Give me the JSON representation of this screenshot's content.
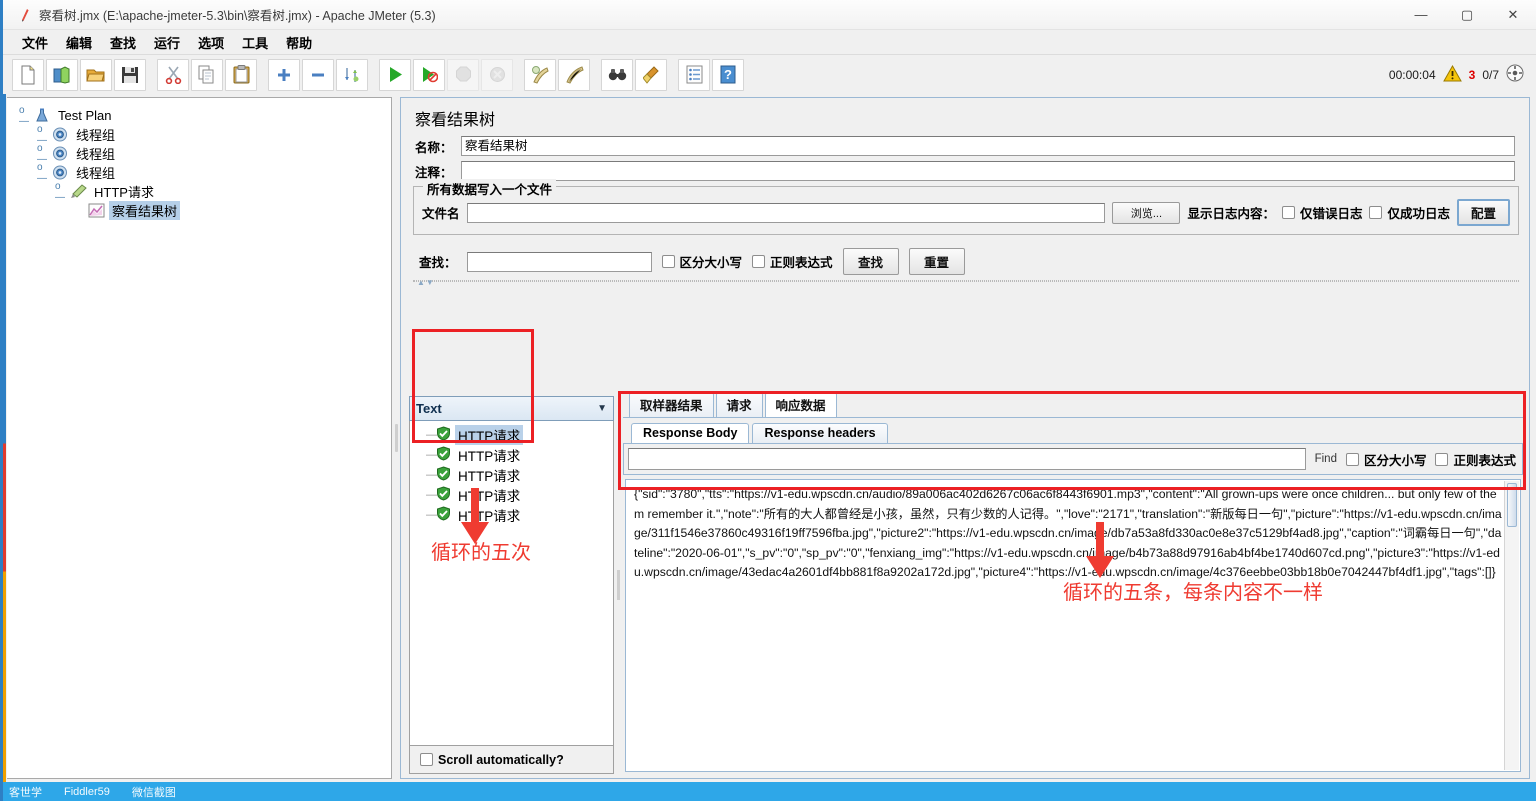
{
  "window": {
    "title": "察看树.jmx (E:\\apache-jmeter-5.3\\bin\\察看树.jmx) - Apache JMeter (5.3)",
    "minimize": "—",
    "maximize": "▢",
    "close": "✕"
  },
  "menu": {
    "items": [
      {
        "label": "文件"
      },
      {
        "label": "编辑"
      },
      {
        "label": "查找"
      },
      {
        "label": "运行"
      },
      {
        "label": "选项"
      },
      {
        "label": "工具"
      },
      {
        "label": "帮助"
      }
    ]
  },
  "toolbar": {
    "buttons": [
      {
        "name": "new-icon",
        "glyph": "📄"
      },
      {
        "name": "templates-icon",
        "glyph": "📚"
      },
      {
        "name": "open-icon",
        "glyph": "📂"
      },
      {
        "name": "save-icon",
        "glyph": "💾"
      },
      {
        "name": "cut-icon",
        "glyph": "✂"
      },
      {
        "name": "copy-icon",
        "glyph": "🗐"
      },
      {
        "name": "paste-icon",
        "glyph": "📋"
      },
      {
        "name": "expand-icon",
        "glyph": "＋"
      },
      {
        "name": "collapse-icon",
        "glyph": "－"
      },
      {
        "name": "toggle-icon",
        "glyph": "⇅"
      },
      {
        "name": "start-icon",
        "glyph": "▶"
      },
      {
        "name": "start-no-pauses-icon",
        "glyph": "▶"
      },
      {
        "name": "stop-icon",
        "glyph": "⬤"
      },
      {
        "name": "shutdown-icon",
        "glyph": "⊗"
      },
      {
        "name": "clear-icon",
        "glyph": "🧹"
      },
      {
        "name": "clear-all-icon",
        "glyph": "🧹"
      },
      {
        "name": "search-icon",
        "glyph": "🔍"
      },
      {
        "name": "reset-search-icon",
        "glyph": "🖌"
      },
      {
        "name": "function-helper-icon",
        "glyph": "📋"
      },
      {
        "name": "help-icon",
        "glyph": "?"
      }
    ],
    "status": {
      "elapsed": "00:00:04",
      "warning_count": "3",
      "threads": "0/7"
    }
  },
  "tree": {
    "nodes": [
      {
        "label": "Test Plan",
        "icon": "test-plan-icon",
        "level": 0,
        "selected": false
      },
      {
        "label": "线程组",
        "icon": "thread-group-icon",
        "level": 1,
        "selected": false
      },
      {
        "label": "线程组",
        "icon": "thread-group-icon",
        "level": 1,
        "selected": false
      },
      {
        "label": "线程组",
        "icon": "thread-group-icon",
        "level": 1,
        "selected": false
      },
      {
        "label": "HTTP请求",
        "icon": "http-request-icon",
        "level": 2,
        "selected": false
      },
      {
        "label": "察看结果树",
        "icon": "view-results-tree-icon",
        "level": 3,
        "selected": true
      }
    ]
  },
  "panel": {
    "title": "察看结果树",
    "name_label": "名称：",
    "name_value": "察看结果树",
    "comment_label": "注释：",
    "comment_value": "",
    "file_group_title": "所有数据写入一个文件",
    "filename_label": "文件名",
    "filename_value": "",
    "browse_button": "浏览...",
    "log_display_label": "显示日志内容：",
    "errors_only_label": "仅错误日志",
    "successes_only_label": "仅成功日志",
    "configure_button": "配置"
  },
  "search": {
    "label": "查找：",
    "value": "",
    "case_sensitive_label": "区分大小写",
    "regex_label": "正则表达式",
    "find_button": "查找",
    "reset_button": "重置"
  },
  "results": {
    "render_selector": "Text",
    "items": [
      {
        "label": "HTTP请求",
        "status": "success",
        "selected": true
      },
      {
        "label": "HTTP请求",
        "status": "success",
        "selected": false
      },
      {
        "label": "HTTP请求",
        "status": "success",
        "selected": false
      },
      {
        "label": "HTTP请求",
        "status": "success",
        "selected": false
      },
      {
        "label": "HTTP请求",
        "status": "success",
        "selected": false
      }
    ],
    "scroll_auto_label": "Scroll automatically?"
  },
  "detail": {
    "tabs": [
      {
        "label": "取样器结果",
        "active": false
      },
      {
        "label": "请求",
        "active": false
      },
      {
        "label": "响应数据",
        "active": true
      }
    ],
    "subtabs": [
      {
        "label": "Response Body",
        "active": true
      },
      {
        "label": "Response headers",
        "active": false
      }
    ],
    "find_value": "",
    "find_button": "Find",
    "case_sensitive_label": "区分大小写",
    "regex_label": "正则表达式",
    "response_body": "{\"sid\":\"3780\",\"tts\":\"https://v1-edu.wpscdn.cn/audio/89a006ac402d6267c06ac6f8443f6901.mp3\",\"content\":\"All grown-ups were once children... but only few of them remember it.\",\"note\":\"所有的大人都曾经是小孩，虽然，只有少数的人记得。\",\"love\":\"2171\",\"translation\":\"新版每日一句\",\"picture\":\"https://v1-edu.wpscdn.cn/image/311f1546e37860c49316f19ff7596fba.jpg\",\"picture2\":\"https://v1-edu.wpscdn.cn/image/db7a53a8fd330ac0e8e37c5129bf4ad8.jpg\",\"caption\":\"词霸每日一句\",\"dateline\":\"2020-06-01\",\"s_pv\":\"0\",\"sp_pv\":\"0\",\"fenxiang_img\":\"https://v1-edu.wpscdn.cn/image/b4b73a88d97916ab4bf4be1740d607cd.png\",\"picture3\":\"https://v1-edu.wpscdn.cn/image/43edac4a2601df4bb881f8a9202a172d.jpg\",\"picture4\":\"https://v1-edu.wpscdn.cn/image/4c376eebbe03bb18b0e7042447bf4df1.jpg\",\"tags\":[]}"
  },
  "annotations": {
    "left_note": "循环的五次",
    "right_note": "循环的五条，每条内容不一样",
    "color": "#ef3b31"
  },
  "taskbar": {
    "items": [
      {
        "label": "客世学"
      },
      {
        "label": "Fiddler59"
      },
      {
        "label": "微信截图"
      }
    ]
  }
}
